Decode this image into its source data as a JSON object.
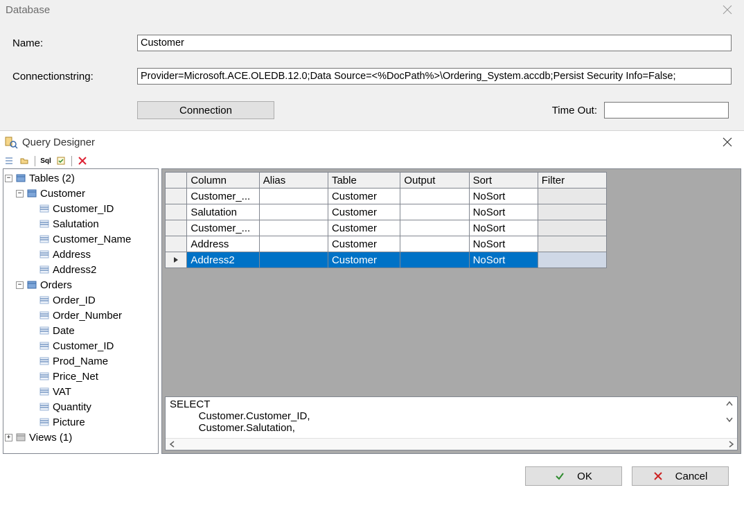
{
  "db": {
    "title": "Database",
    "name_label": "Name:",
    "name_value": "Customer",
    "conn_label": "Connectionstring:",
    "conn_value": "Provider=Microsoft.ACE.OLEDB.12.0;Data Source=<%DocPath%>\\Ordering_System.accdb;Persist Security Info=False;",
    "conn_btn": "Connection",
    "timeout_label": "Time Out:",
    "timeout_value": ""
  },
  "qd": {
    "title": "Query Designer",
    "tree": {
      "root_tables": "Tables (2)",
      "customer": "Customer",
      "customer_cols": [
        "Customer_ID",
        "Salutation",
        "Customer_Name",
        "Address",
        "Address2"
      ],
      "orders": "Orders",
      "orders_cols": [
        "Order_ID",
        "Order_Number",
        "Date",
        "Customer_ID",
        "Prod_Name",
        "Price_Net",
        "VAT",
        "Quantity",
        "Picture"
      ],
      "root_views": "Views (1)"
    },
    "grid": {
      "headers": [
        "Column",
        "Alias",
        "Table",
        "Output",
        "Sort",
        "Filter"
      ],
      "rows": [
        {
          "column": "Customer_...",
          "alias": "",
          "table": "Customer",
          "output": "",
          "sort": "NoSort",
          "filter": "",
          "selected": false
        },
        {
          "column": "Salutation",
          "alias": "",
          "table": "Customer",
          "output": "",
          "sort": "NoSort",
          "filter": "",
          "selected": false
        },
        {
          "column": "Customer_...",
          "alias": "",
          "table": "Customer",
          "output": "",
          "sort": "NoSort",
          "filter": "",
          "selected": false
        },
        {
          "column": "Address",
          "alias": "",
          "table": "Customer",
          "output": "",
          "sort": "NoSort",
          "filter": "",
          "selected": false
        },
        {
          "column": "Address2",
          "alias": "",
          "table": "Customer",
          "output": "",
          "sort": "NoSort",
          "filter": "",
          "selected": true
        }
      ]
    },
    "sql_lines": [
      "SELECT",
      "          Customer.Customer_ID,",
      "          Customer.Salutation,"
    ]
  },
  "footer": {
    "ok": "OK",
    "cancel": "Cancel"
  }
}
